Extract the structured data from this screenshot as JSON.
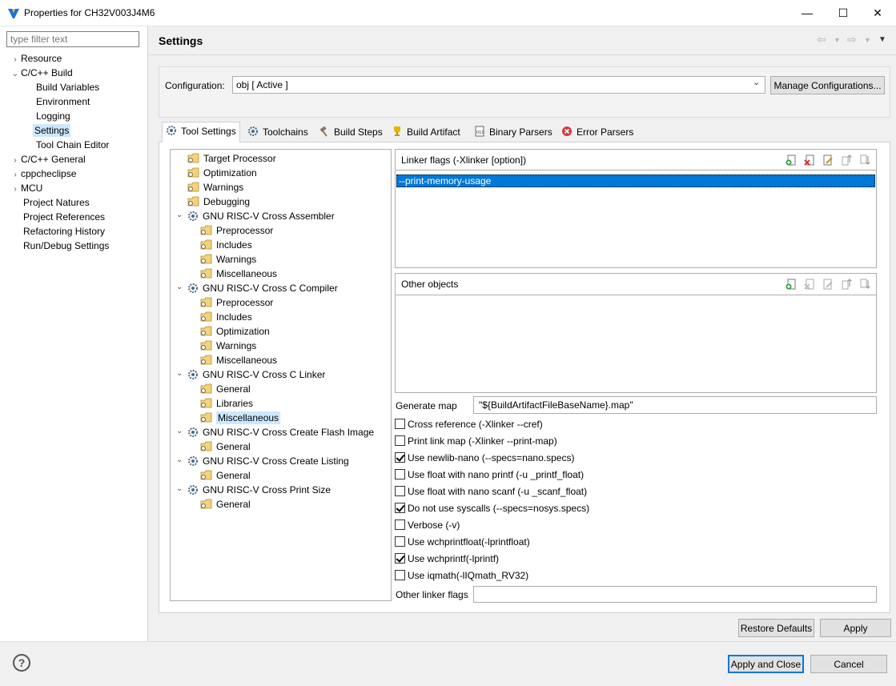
{
  "window": {
    "title": "Properties for CH32V003J4M6",
    "min_icon": "minimize-icon",
    "max_icon": "maximize-icon",
    "close_icon": "close-icon"
  },
  "sidebar": {
    "filter_placeholder": "type filter text",
    "items": [
      {
        "label": "Resource",
        "twisty": "›"
      },
      {
        "label": "C/C++ Build",
        "twisty": "⌄"
      },
      {
        "label": "Build Variables"
      },
      {
        "label": "Environment"
      },
      {
        "label": "Logging"
      },
      {
        "label": "Settings"
      },
      {
        "label": "Tool Chain Editor"
      },
      {
        "label": "C/C++ General",
        "twisty": "›"
      },
      {
        "label": "cppcheclipse",
        "twisty": "›"
      },
      {
        "label": "MCU",
        "twisty": "›"
      },
      {
        "label": "Project Natures"
      },
      {
        "label": "Project References"
      },
      {
        "label": "Refactoring History"
      },
      {
        "label": "Run/Debug Settings"
      }
    ]
  },
  "header": {
    "title": "Settings"
  },
  "configuration": {
    "label": "Configuration:",
    "value": "obj  [ Active ]",
    "manage_label": "Manage Configurations..."
  },
  "tabs": [
    {
      "label": "Tool Settings"
    },
    {
      "label": "Toolchains"
    },
    {
      "label": "Build Steps"
    },
    {
      "label": "Build Artifact"
    },
    {
      "label": "Binary Parsers"
    },
    {
      "label": "Error Parsers"
    }
  ],
  "tooltree": [
    {
      "label": "Target Processor"
    },
    {
      "label": "Optimization"
    },
    {
      "label": "Warnings"
    },
    {
      "label": "Debugging"
    },
    {
      "label": "GNU RISC-V Cross Assembler"
    },
    {
      "label": "Preprocessor"
    },
    {
      "label": "Includes"
    },
    {
      "label": "Warnings"
    },
    {
      "label": "Miscellaneous"
    },
    {
      "label": "GNU RISC-V Cross C Compiler"
    },
    {
      "label": "Preprocessor"
    },
    {
      "label": "Includes"
    },
    {
      "label": "Optimization"
    },
    {
      "label": "Warnings"
    },
    {
      "label": "Miscellaneous"
    },
    {
      "label": "GNU RISC-V Cross C Linker"
    },
    {
      "label": "General"
    },
    {
      "label": "Libraries"
    },
    {
      "label": "Miscellaneous"
    },
    {
      "label": "GNU RISC-V Cross Create Flash Image"
    },
    {
      "label": "General"
    },
    {
      "label": "GNU RISC-V Cross Create Listing"
    },
    {
      "label": "General"
    },
    {
      "label": "GNU RISC-V Cross Print Size"
    },
    {
      "label": "General"
    }
  ],
  "linker_flags": {
    "title": "Linker flags (-Xlinker [option])",
    "items": [
      "--print-memory-usage"
    ]
  },
  "other_objects": {
    "title": "Other objects"
  },
  "generate_map": {
    "label": "Generate map",
    "value": "\"${BuildArtifactFileBaseName}.map\""
  },
  "options": [
    {
      "label": "Cross reference (-Xlinker --cref)",
      "checked": false
    },
    {
      "label": "Print link map (-Xlinker --print-map)",
      "checked": false
    },
    {
      "label": "Use newlib-nano (--specs=nano.specs)",
      "checked": true
    },
    {
      "label": "Use float with nano printf (-u _printf_float)",
      "checked": false
    },
    {
      "label": "Use float with nano scanf (-u _scanf_float)",
      "checked": false
    },
    {
      "label": "Do not use syscalls (--specs=nosys.specs)",
      "checked": true
    },
    {
      "label": "Verbose (-v)",
      "checked": false
    },
    {
      "label": "Use wchprintfloat(-lprintfloat)",
      "checked": false
    },
    {
      "label": "Use wchprintf(-lprintf)",
      "checked": true
    },
    {
      "label": "Use iqmath(-lIQmath_RV32)",
      "checked": false
    }
  ],
  "other_linker_flags": {
    "label": "Other linker flags",
    "value": ""
  },
  "buttons": {
    "restore_defaults": "Restore Defaults",
    "apply": "Apply",
    "apply_close": "Apply and Close",
    "cancel": "Cancel",
    "help": "?"
  }
}
